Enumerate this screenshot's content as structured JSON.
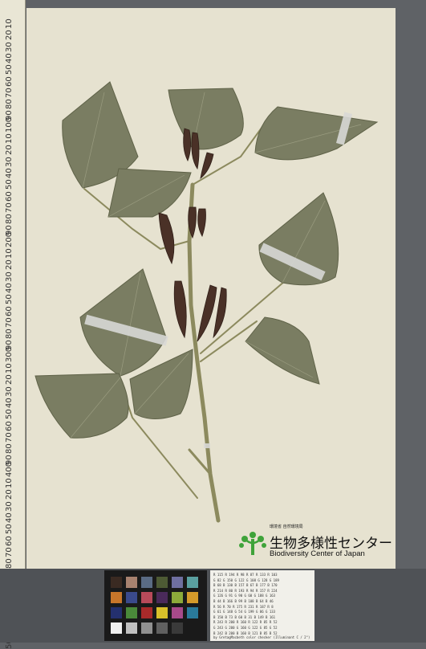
{
  "ruler": {
    "labels": [
      "10",
      "20",
      "30",
      "40",
      "50",
      "60",
      "70",
      "80",
      "90",
      "100",
      "10",
      "20",
      "30",
      "40",
      "50",
      "60",
      "70",
      "80",
      "90",
      "200",
      "10",
      "20",
      "30",
      "40",
      "50",
      "60",
      "70",
      "80",
      "90",
      "300",
      "10",
      "20",
      "30",
      "40",
      "50",
      "60",
      "70",
      "80",
      "90",
      "400",
      "10",
      "20",
      "30",
      "40",
      "50",
      "60",
      "70",
      "80",
      "90",
      "500",
      "10",
      "20",
      "30",
      "40",
      "50"
    ]
  },
  "label": {
    "ministry_line": "環境省 自然環境局",
    "name_jp": "生物多様性センター",
    "name_en": "Biodiversity Center of Japan"
  },
  "colors": {
    "leaf": "#7a7d62",
    "stem": "#8c8a5e",
    "flower": "#4a3127",
    "logo_green": "#3fa33a",
    "tape": "#d8d8d6"
  },
  "color_checker": {
    "swatches": [
      "#3a2a22",
      "#a8826f",
      "#5a6b84",
      "#4d5a34",
      "#6f6fa0",
      "#5aa0a0",
      "#c8762a",
      "#3a4a8c",
      "#b84a5a",
      "#4a2a5a",
      "#8caa3a",
      "#d49a2a",
      "#24306e",
      "#4a8a3a",
      "#a82a2a",
      "#d8c02a",
      "#a84a8a",
      "#2a7a9a",
      "#f0f0f0",
      "#c0c0c0",
      "#909090",
      "#606060",
      "#3a3a3a",
      "#1a1a1a"
    ]
  },
  "reference_card": {
    "rows": [
      "R 115  R 194  R 98   R 87   R 133  R 103",
      "G 82   G 150  G 122  G 108  G 128  G 189",
      "B 68   B 130  B 157  B 67   B 177  B 170",
      "R 214  R 80   R 193  R 94   R 157  R 224",
      "G 126  G 91   G 90   G 60   G 188  G 163",
      "B 44   B 166  B 99   B 108  B 64   B 46",
      "R 56   R 70   R 175  R 231  R 187  R 8",
      "G 61   G 148  G 54   G 199  G 86   G 133",
      "B 150  B 73   B 60   B 31   B 149  B 161",
      "R 243  R 200  R 160  R 122  R 85   R 52",
      "G 243  G 200  G 160  G 122  G 85   G 52",
      "B 242  B 200  B 160  B 121  B 85   B 52"
    ],
    "footer": "by GretagMacbeth color checker (Illuminant C / 2°)"
  }
}
